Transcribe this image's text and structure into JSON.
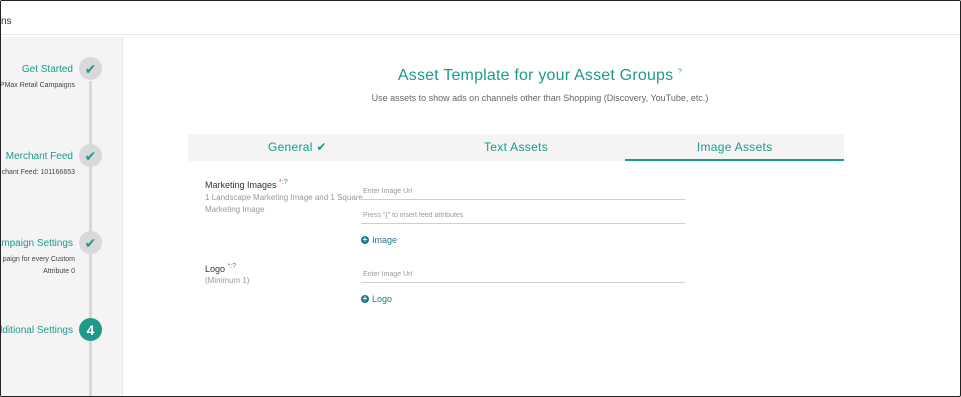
{
  "topbar": {
    "text": "ns"
  },
  "sidebar": {
    "steps": [
      {
        "title": "Get Started",
        "subtitle": "PMax Retail Campaigns",
        "state": "done"
      },
      {
        "title": "Merchant Feed",
        "subtitle": "chant Feed: 101166653",
        "state": "done"
      },
      {
        "title": "Campaign Settings",
        "subtitle_line1": "paign for every Custom",
        "subtitle_line2": "Attribute 0",
        "state": "done"
      },
      {
        "title": "Additional Settings",
        "number": "4",
        "state": "active"
      }
    ]
  },
  "main": {
    "title": "Asset Template for your Asset Groups",
    "help_mark": "?",
    "subtitle": "Use assets to show ads on channels other than Shopping (Discovery, YouTube, etc.)",
    "tabs": [
      {
        "label": "General",
        "tick": "✔"
      },
      {
        "label": "Text Assets"
      },
      {
        "label": "Image Assets",
        "active": true
      }
    ],
    "fields": {
      "marketing_images": {
        "label": "Marketing Images",
        "required_mark": "*:",
        "help": "?",
        "hint_line1": "1 Landscape Marketing Image and 1 Square",
        "hint_line2": "Marketing Image",
        "input1_placeholder": "Enter Image Url",
        "input2_placeholder": "Press \"{\" to insert feed attributes",
        "add_label": "Image"
      },
      "logo": {
        "label": "Logo",
        "required_mark": "*:",
        "help": "?",
        "hint": "(Minimum 1)",
        "input_placeholder": "Enter Image Url",
        "add_label": "Logo"
      }
    }
  },
  "colors": {
    "accent": "#1d9a8c",
    "sidebar_bg": "#f4f4f4",
    "step_gray": "#d9d9d9"
  }
}
